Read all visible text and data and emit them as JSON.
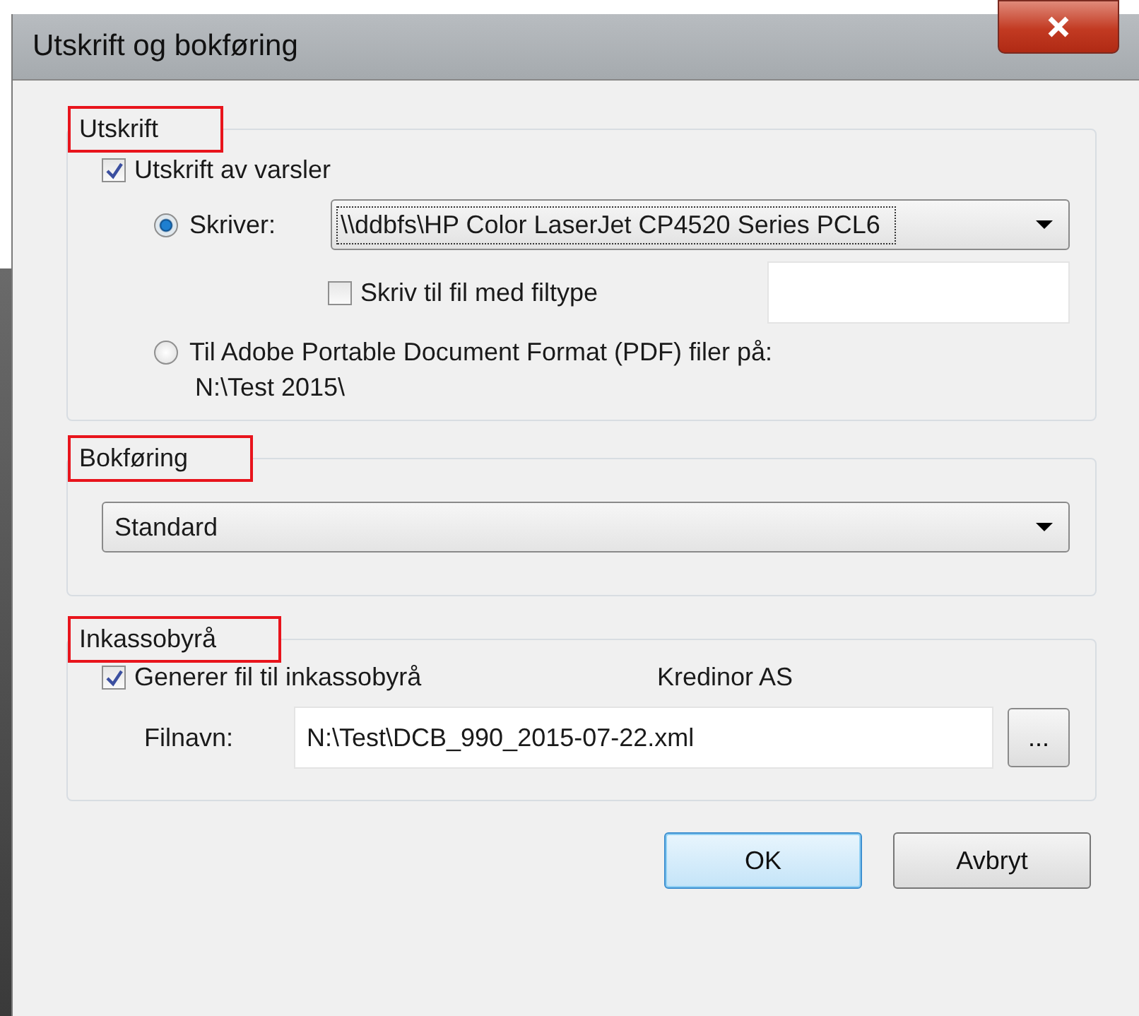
{
  "window": {
    "title": "Utskrift og bokføring"
  },
  "print_section": {
    "title": "Utskrift",
    "highlighted": true,
    "print_notices": {
      "label": "Utskrift av varsler",
      "checked": true
    },
    "printer_option": {
      "label": "Skriver:",
      "selected": true,
      "value": "\\\\ddbfs\\HP Color LaserJet CP4520 Series PCL6"
    },
    "file_option": {
      "label": "Skriv til fil med filtype",
      "checked": false
    },
    "pdf_option": {
      "label": "Til Adobe Portable Document Format (PDF) filer på:",
      "selected": false,
      "path": "N:\\Test 2015\\"
    }
  },
  "posting_section": {
    "title": "Bokføring",
    "highlighted": true,
    "value": "Standard"
  },
  "collection_section": {
    "title": "Inkassobyrå",
    "highlighted": true,
    "generate": {
      "label": "Generer fil til inkassobyrå",
      "checked": true
    },
    "agency": "Kredinor AS",
    "filename_label": "Filnavn:",
    "filename": "N:\\Test\\DCB_990_2015-07-22.xml",
    "browse": "..."
  },
  "buttons": [
    {
      "label": "OK",
      "default": true
    },
    {
      "label": "Avbryt",
      "default": false
    }
  ]
}
